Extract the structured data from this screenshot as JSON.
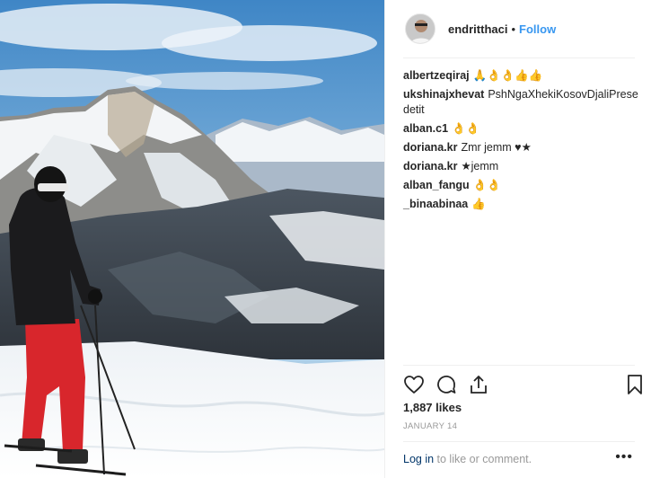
{
  "post": {
    "username": "endritthaci",
    "separator": "•",
    "follow_label": "Follow"
  },
  "comments": [
    {
      "user": "albertzeqiraj",
      "text": "🙏👌👌👍👍"
    },
    {
      "user": "ukshinajxhevat",
      "text": "PshNgaXhekiKosovDjaliPresedetit"
    },
    {
      "user": "alban.c1",
      "text": "👌👌"
    },
    {
      "user": "doriana.kr",
      "text": "Zmr jemm ♥★"
    },
    {
      "user": "doriana.kr",
      "text": "★jemm"
    },
    {
      "user": "alban_fangu",
      "text": "👌👌"
    },
    {
      "user": "_binaabinaa",
      "text": "👍"
    }
  ],
  "likes": "1,887 likes",
  "date": "JANUARY 14",
  "footer": {
    "login_link": "Log in",
    "login_suffix": " to like or comment.",
    "more_label": "•••"
  },
  "icons": {
    "like": "heart-icon",
    "comment": "speech-bubble-icon",
    "share": "share-icon",
    "save": "bookmark-icon"
  },
  "colors": {
    "link": "#3897f0",
    "muted": "#999999",
    "text": "#262626"
  }
}
